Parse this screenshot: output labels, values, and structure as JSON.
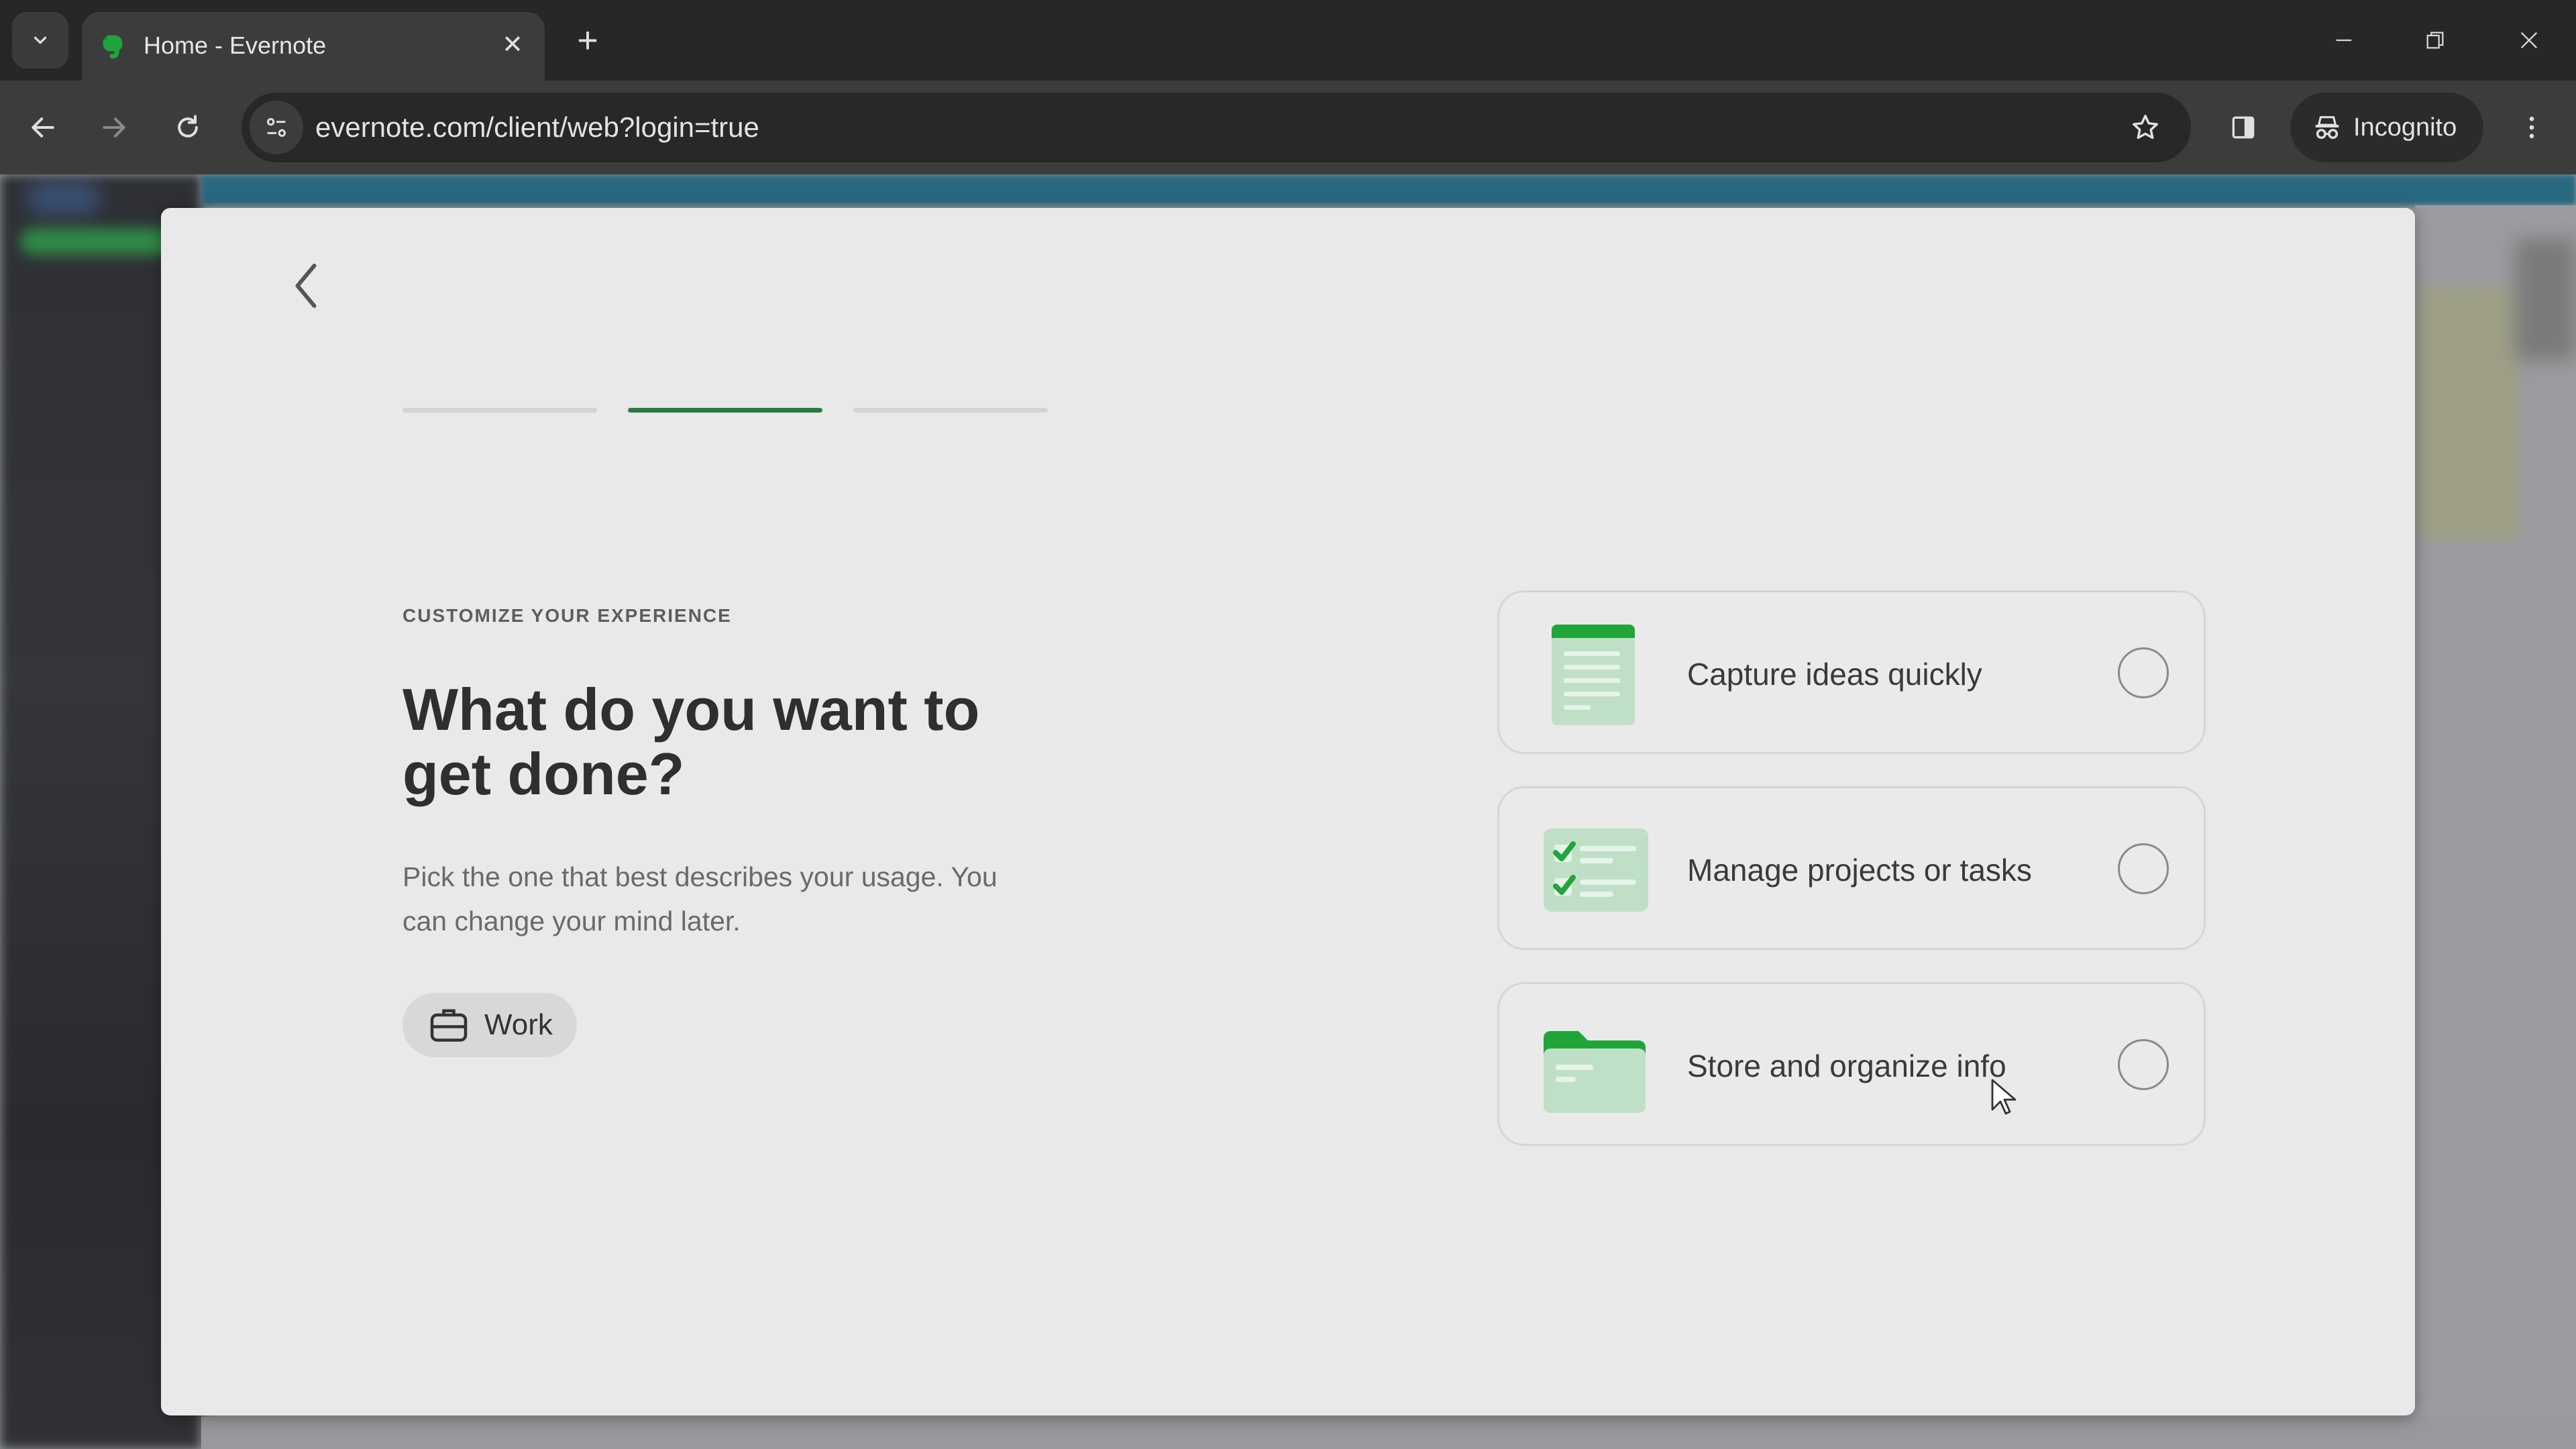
{
  "browser": {
    "tab": {
      "title": "Home - Evernote",
      "favicon": "evernote-elephant-icon"
    },
    "address_bar": {
      "url": "evernote.com/client/web?login=true"
    },
    "profile": {
      "label": "Incognito"
    },
    "icons": {
      "tab_list": "chevron-down-icon",
      "close_tab": "close-icon",
      "new_tab": "plus-icon",
      "minimize": "minimize-icon",
      "restore": "restore-icon",
      "close_window": "close-icon",
      "back": "arrow-left-icon",
      "forward": "arrow-right-icon",
      "reload": "reload-icon",
      "site_info": "tune-icon",
      "bookmark": "star-icon",
      "side_panel": "side-panel-icon",
      "incognito": "incognito-icon",
      "menu": "kebab-menu-icon"
    },
    "glyphs": {
      "close_tab": "✕",
      "new_tab": "+"
    }
  },
  "onboarding": {
    "progress": {
      "total_steps": 3,
      "current_step": 2
    },
    "eyebrow": "CUSTOMIZE YOUR EXPERIENCE",
    "heading": "What do you want to get done?",
    "description": "Pick the one that best describes your usage. You can change your mind later.",
    "selected_chip": {
      "label": "Work",
      "icon": "briefcase-icon"
    },
    "options": [
      {
        "label": "Capture ideas quickly",
        "icon": "note-icon",
        "selected": false
      },
      {
        "label": "Manage projects or tasks",
        "icon": "checklist-icon",
        "selected": false
      },
      {
        "label": "Store and organize info",
        "icon": "folder-icon",
        "selected": false
      }
    ],
    "colors": {
      "accent_green": "#2b7a3f",
      "illustration_green": "#20a53b",
      "illustration_light": "#bfe0c6"
    }
  }
}
